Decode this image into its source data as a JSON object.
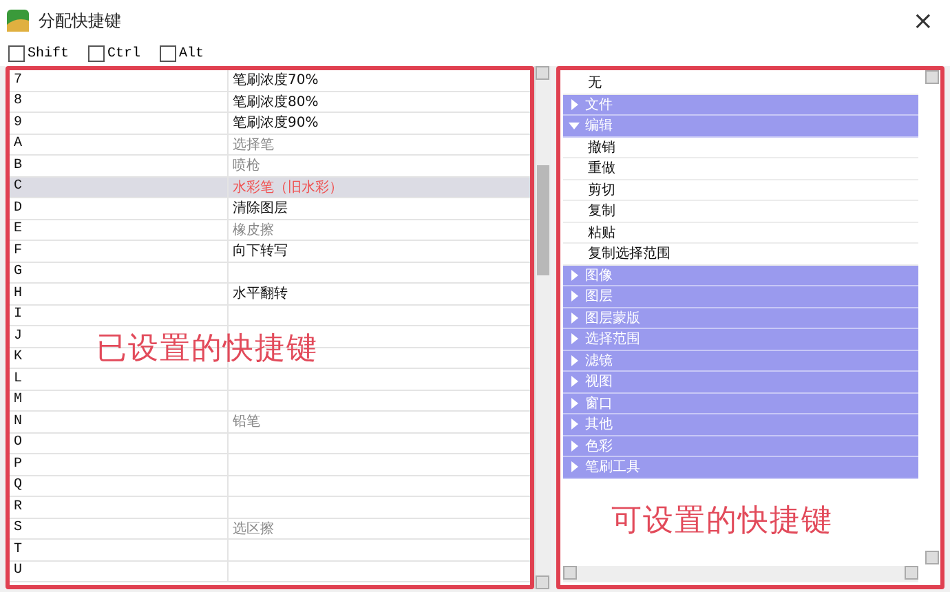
{
  "window": {
    "title": "分配快捷键",
    "close": "×"
  },
  "modifiers": [
    {
      "label": "Shift",
      "checked": false
    },
    {
      "label": "Ctrl",
      "checked": false
    },
    {
      "label": "Alt",
      "checked": false
    }
  ],
  "assigned": {
    "annotation": "已设置的快捷键",
    "rows": [
      {
        "key": "7",
        "action": "笔刷浓度70%",
        "dimmed": false,
        "selected": false
      },
      {
        "key": "8",
        "action": "笔刷浓度80%",
        "dimmed": false,
        "selected": false
      },
      {
        "key": "9",
        "action": "笔刷浓度90%",
        "dimmed": false,
        "selected": false
      },
      {
        "key": "A",
        "action": "选择笔",
        "dimmed": true,
        "selected": false
      },
      {
        "key": "B",
        "action": "喷枪",
        "dimmed": true,
        "selected": false
      },
      {
        "key": "C",
        "action": "水彩笔（旧水彩）",
        "selected": true
      },
      {
        "key": "D",
        "action": "清除图层",
        "dimmed": false,
        "selected": false
      },
      {
        "key": "E",
        "action": "橡皮擦",
        "dimmed": true,
        "selected": false
      },
      {
        "key": "F",
        "action": "向下转写",
        "dimmed": false,
        "selected": false
      },
      {
        "key": "G",
        "selected": false
      },
      {
        "key": "H",
        "action": "水平翻转",
        "dimmed": false,
        "selected": false
      },
      {
        "key": "I",
        "selected": false
      },
      {
        "key": "J",
        "selected": false
      },
      {
        "key": "K",
        "selected": false
      },
      {
        "key": "L",
        "selected": false
      },
      {
        "key": "M",
        "selected": false
      },
      {
        "key": "N",
        "action": "铅笔",
        "dimmed": true,
        "selected": false
      },
      {
        "key": "O",
        "selected": false
      },
      {
        "key": "P",
        "selected": false
      },
      {
        "key": "Q",
        "selected": false
      },
      {
        "key": "R",
        "selected": false
      },
      {
        "key": "S",
        "action": "选区擦",
        "dimmed": true,
        "selected": false
      },
      {
        "key": "T",
        "selected": false
      },
      {
        "key": "U",
        "selected": false
      }
    ]
  },
  "available": {
    "annotation": "可设置的快捷键",
    "items": [
      {
        "kind": "item",
        "label": "无"
      },
      {
        "kind": "category",
        "label": "文件",
        "expanded": false
      },
      {
        "kind": "category",
        "label": "编辑",
        "expanded": true,
        "children": [
          {
            "label": "撤销"
          },
          {
            "label": "重做"
          },
          {
            "label": "剪切"
          },
          {
            "label": "复制"
          },
          {
            "label": "粘贴"
          },
          {
            "label": "复制选择范围"
          }
        ]
      },
      {
        "kind": "category",
        "label": "图像",
        "expanded": false
      },
      {
        "kind": "category",
        "label": "图层",
        "expanded": false
      },
      {
        "kind": "category",
        "label": "图层蒙版",
        "expanded": false
      },
      {
        "kind": "category",
        "label": "选择范围",
        "expanded": false
      },
      {
        "kind": "category",
        "label": "滤镜",
        "expanded": false
      },
      {
        "kind": "category",
        "label": "视图",
        "expanded": false
      },
      {
        "kind": "category",
        "label": "窗口",
        "expanded": false
      },
      {
        "kind": "category",
        "label": "其他",
        "expanded": false
      },
      {
        "kind": "category",
        "label": "色彩",
        "expanded": false
      },
      {
        "kind": "category",
        "label": "笔刷工具",
        "expanded": false
      }
    ]
  }
}
